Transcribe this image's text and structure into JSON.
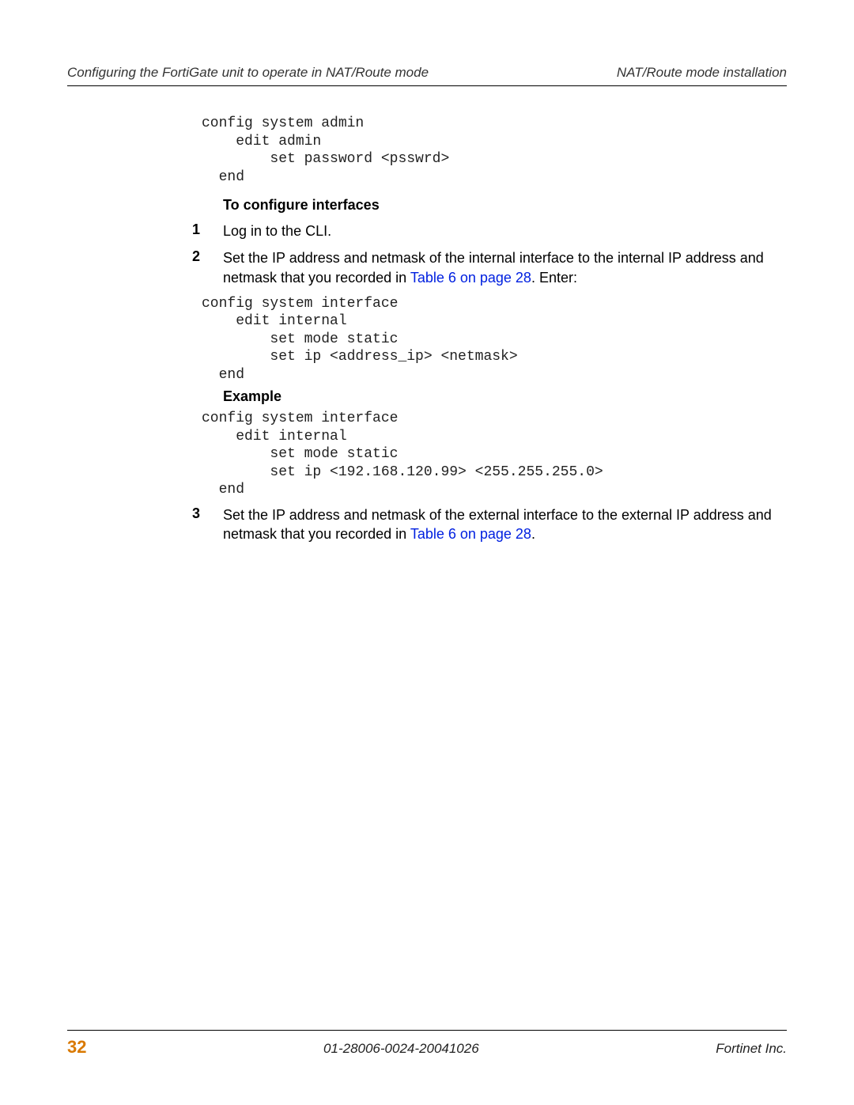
{
  "header": {
    "left": "Configuring the FortiGate unit to operate in NAT/Route mode",
    "right": "NAT/Route mode installation"
  },
  "code1": "config system admin\n    edit admin\n        set password <psswrd>\n  end",
  "heading1": "To configure interfaces",
  "steps_a": [
    {
      "num": "1",
      "text_before": "Log in to the CLI.",
      "link": "",
      "text_after": ""
    },
    {
      "num": "2",
      "text_before": "Set the IP address and netmask of the internal interface to the internal IP address and netmask that you recorded in ",
      "link": "Table 6 on page 28",
      "text_after": ". Enter:"
    }
  ],
  "code2": "config system interface\n    edit internal\n        set mode static\n        set ip <address_ip> <netmask>\n  end",
  "heading2": "Example",
  "code3": "config system interface\n    edit internal\n        set mode static\n        set ip <192.168.120.99> <255.255.255.0>\n  end",
  "steps_b": [
    {
      "num": "3",
      "text_before": "Set the IP address and netmask of the external interface to the external IP address and netmask that you recorded in ",
      "link": "Table 6 on page 28",
      "text_after": "."
    }
  ],
  "footer": {
    "page": "32",
    "docid": "01-28006-0024-20041026",
    "company": "Fortinet Inc."
  }
}
